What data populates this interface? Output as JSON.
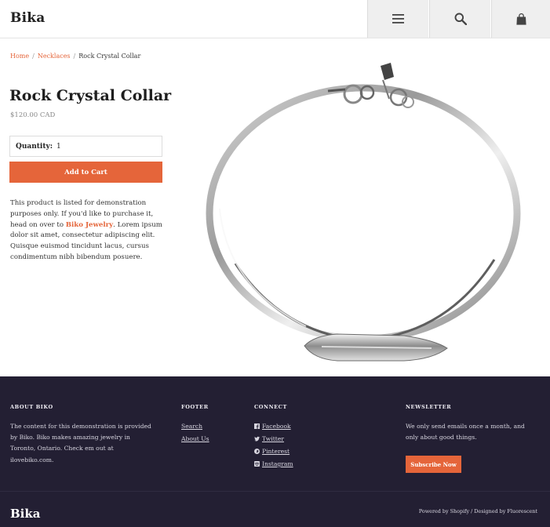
{
  "header": {
    "logo": "Bika",
    "icons": [
      "menu-icon",
      "search-icon",
      "cart-icon"
    ]
  },
  "breadcrumb": {
    "home": "Home",
    "sep1": "/",
    "category": "Necklaces",
    "sep2": "/",
    "current": "Rock Crystal Collar"
  },
  "product": {
    "title": "Rock Crystal Collar",
    "price": "$120.00 CAD",
    "quantity_label": "Quantity:",
    "quantity_value": "1",
    "add_to_cart": "Add to Cart",
    "desc_pre": "This product is listed for demonstration purposes only. If you'd like to purchase it, head on over to ",
    "desc_link": "Biko Jewelry",
    "desc_post": ". Lorem ipsum dolor sit amet, consectetur adipiscing elit. Quisque euismod tincidunt lacus, cursus condimentum nibh bibendum posuere."
  },
  "footer": {
    "about_heading": "ABOUT BIKO",
    "about_text": "The content for this demonstration is provided by Biko. Biko makes amazing jewelry in Toronto, Ontario. Check em out at ilovebiko.com.",
    "footer_heading": "FOOTER",
    "footer_links": [
      "Search",
      "About Us"
    ],
    "connect_heading": "CONNECT",
    "connect_links": [
      {
        "label": "Facebook",
        "icon": "facebook-icon"
      },
      {
        "label": "Twitter",
        "icon": "twitter-icon"
      },
      {
        "label": "Pinterest",
        "icon": "pinterest-icon"
      },
      {
        "label": "Instagram",
        "icon": "instagram-icon"
      }
    ],
    "newsletter_heading": "NEWSLETTER",
    "newsletter_text": "We only send emails once a month, and only about good things.",
    "subscribe": "Subscribe Now",
    "logo": "Bika",
    "credits": "Powered by Shopify / Designed by Fluorescent"
  },
  "colors": {
    "accent": "#e5653a",
    "footer_bg": "#231f33",
    "header_button_bg": "#efefef"
  }
}
